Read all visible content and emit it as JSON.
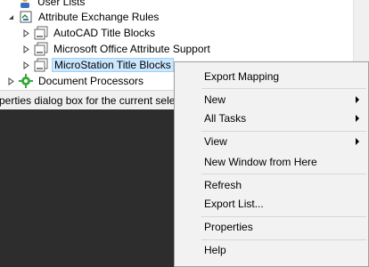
{
  "tree": {
    "items": [
      {
        "label": "User Lists",
        "icon": "user-list-icon",
        "expander": "none"
      },
      {
        "label": "Attribute Exchange Rules",
        "icon": "attribute-rules-icon",
        "expander": "expanded"
      },
      {
        "label": "AutoCAD Title Blocks",
        "icon": "title-block-icon",
        "expander": "collapsed"
      },
      {
        "label": "Microsoft Office Attribute Support",
        "icon": "title-block-icon",
        "expander": "collapsed"
      },
      {
        "label": "MicroStation Title Blocks",
        "icon": "title-block-icon",
        "expander": "collapsed",
        "selected": true
      },
      {
        "label": "Document Processors",
        "icon": "gear-icon",
        "expander": "collapsed"
      }
    ]
  },
  "status_bar": {
    "text": "perties dialog box for the current sele"
  },
  "context_menu": {
    "items": [
      {
        "label": "Export Mapping",
        "submenu": false
      },
      {
        "label": "New",
        "submenu": true
      },
      {
        "label": "All Tasks",
        "submenu": true
      },
      {
        "label": "View",
        "submenu": true
      },
      {
        "label": "New Window from Here",
        "submenu": false
      },
      {
        "label": "Refresh",
        "submenu": false
      },
      {
        "label": "Export List...",
        "submenu": false
      },
      {
        "label": "Properties",
        "submenu": false
      },
      {
        "label": "Help",
        "submenu": false
      }
    ]
  },
  "colors": {
    "selection_fill": "#cce8ff",
    "selection_border": "#99d1ff",
    "menu_background": "#f2f2f2",
    "dark_background": "#2d2d2d"
  }
}
